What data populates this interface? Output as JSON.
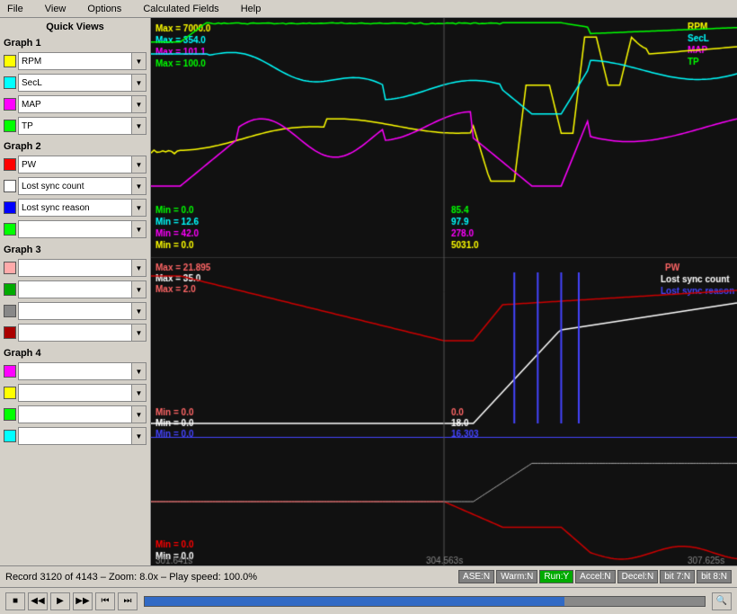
{
  "menubar": {
    "items": [
      "File",
      "View",
      "Options",
      "Calculated Fields",
      "Help"
    ]
  },
  "sidebar": {
    "quick_views_title": "Quick Views",
    "graph1": {
      "title": "Graph 1",
      "channels": [
        {
          "name": "RPM",
          "color": "#ffff00"
        },
        {
          "name": "SecL",
          "color": "#00ffff"
        },
        {
          "name": "MAP",
          "color": "#ff00ff"
        },
        {
          "name": "TP",
          "color": "#00ff00"
        }
      ]
    },
    "graph2": {
      "title": "Graph 2",
      "channels": [
        {
          "name": "PW",
          "color": "#ff0000"
        },
        {
          "name": "Lost sync count",
          "color": "#ffffff"
        },
        {
          "name": "Lost sync reason",
          "color": "#0000ff"
        },
        {
          "name": "",
          "color": "#00ff00"
        }
      ]
    },
    "graph3": {
      "title": "Graph 3",
      "channels": [
        {
          "name": "",
          "color": "#ffaaaa"
        },
        {
          "name": "",
          "color": "#00aa00"
        },
        {
          "name": "",
          "color": "#888888"
        },
        {
          "name": "",
          "color": "#aa0000"
        }
      ]
    },
    "graph4": {
      "title": "Graph 4",
      "channels": [
        {
          "name": "",
          "color": "#ff00ff"
        },
        {
          "name": "",
          "color": "#ffff00"
        },
        {
          "name": "",
          "color": "#00ff00"
        },
        {
          "name": "",
          "color": "#00ffff"
        }
      ]
    }
  },
  "chart": {
    "graph1": {
      "maxes": [
        "Max = 7000.0",
        "Max = 354.0",
        "Max = 101.1",
        "Max = 100.0"
      ],
      "mins": [
        "Min = 0.0",
        "Min = 12.6",
        "Min = 42.0",
        "Min = 0.0"
      ],
      "mid_values": [
        "85.4",
        "97.9",
        "278.0",
        "5031.0"
      ],
      "legend": [
        "RPM",
        "SecL",
        "MAP",
        "TP"
      ]
    },
    "graph2": {
      "maxes": [
        "Max = 21.895",
        "Max = 35.0",
        "Max = 2.0"
      ],
      "mins": [
        "Min = 0.0",
        "Min = 0.0",
        "Min = 0.0"
      ],
      "mid_values": [
        "0.0",
        "18.0",
        "16.303"
      ],
      "legend": [
        "PW",
        "Lost sync count",
        "Lost sync reason"
      ]
    },
    "time_labels": [
      "301.641s",
      "304.563s",
      "307.625s"
    ]
  },
  "statusbar": {
    "record_info": "Record 3120 of 4143 – Zoom: 8.0x – Play speed: 100.0%",
    "badges": [
      "ASE:N",
      "Warm:N",
      "Run:Y",
      "Accel:N",
      "Decel:N",
      "bit 7:N",
      "bit 8:N"
    ]
  },
  "controls": {
    "buttons": [
      "■",
      "◀◀",
      "▶",
      "▶▶",
      "⏮",
      "⏭",
      "🔍"
    ]
  }
}
